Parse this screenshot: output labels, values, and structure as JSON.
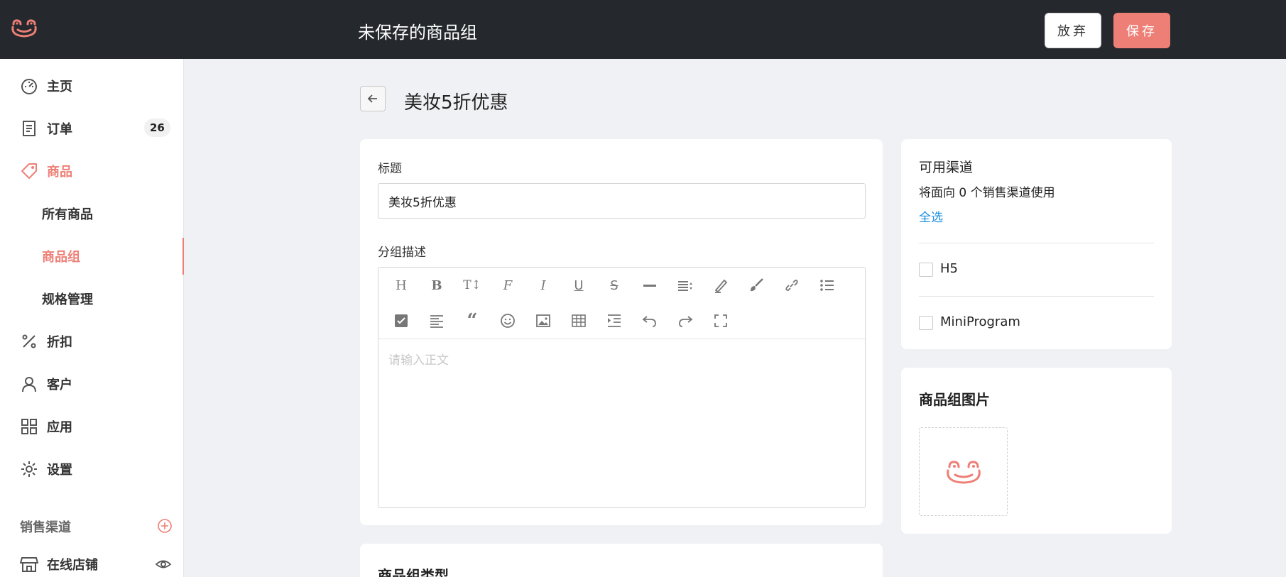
{
  "header": {
    "title": "未保存的商品组",
    "discard_label": "放弃",
    "save_label": "保存"
  },
  "sidebar": {
    "items": [
      {
        "label": "主页",
        "icon": "dashboard-icon"
      },
      {
        "label": "订单",
        "icon": "orders-icon",
        "badge": "26"
      },
      {
        "label": "商品",
        "icon": "tag-icon",
        "active": true
      },
      {
        "label": "所有商品",
        "sub": true
      },
      {
        "label": "商品组",
        "sub": true,
        "active": true
      },
      {
        "label": "规格管理",
        "sub": true
      },
      {
        "label": "折扣",
        "icon": "percent-icon"
      },
      {
        "label": "客户",
        "icon": "user-icon"
      },
      {
        "label": "应用",
        "icon": "apps-icon"
      },
      {
        "label": "设置",
        "icon": "gear-icon"
      }
    ],
    "channels_label": "销售渠道",
    "online_store_label": "在线店铺"
  },
  "main": {
    "page_title": "美妆5折优惠",
    "title_label": "标题",
    "title_value": "美妆5折优惠",
    "desc_label": "分组描述",
    "editor_placeholder": "请输入正文",
    "type_title": "商品组类型"
  },
  "channels": {
    "title": "可用渠道",
    "subtitle": "将面向 0 个销售渠道使用",
    "select_all": "全选",
    "options": [
      "H5",
      "MiniProgram"
    ]
  },
  "image_card": {
    "title": "商品组图片"
  },
  "colors": {
    "accent": "#ee7f76",
    "topbar": "#25292d",
    "link": "#1a8fe0"
  }
}
